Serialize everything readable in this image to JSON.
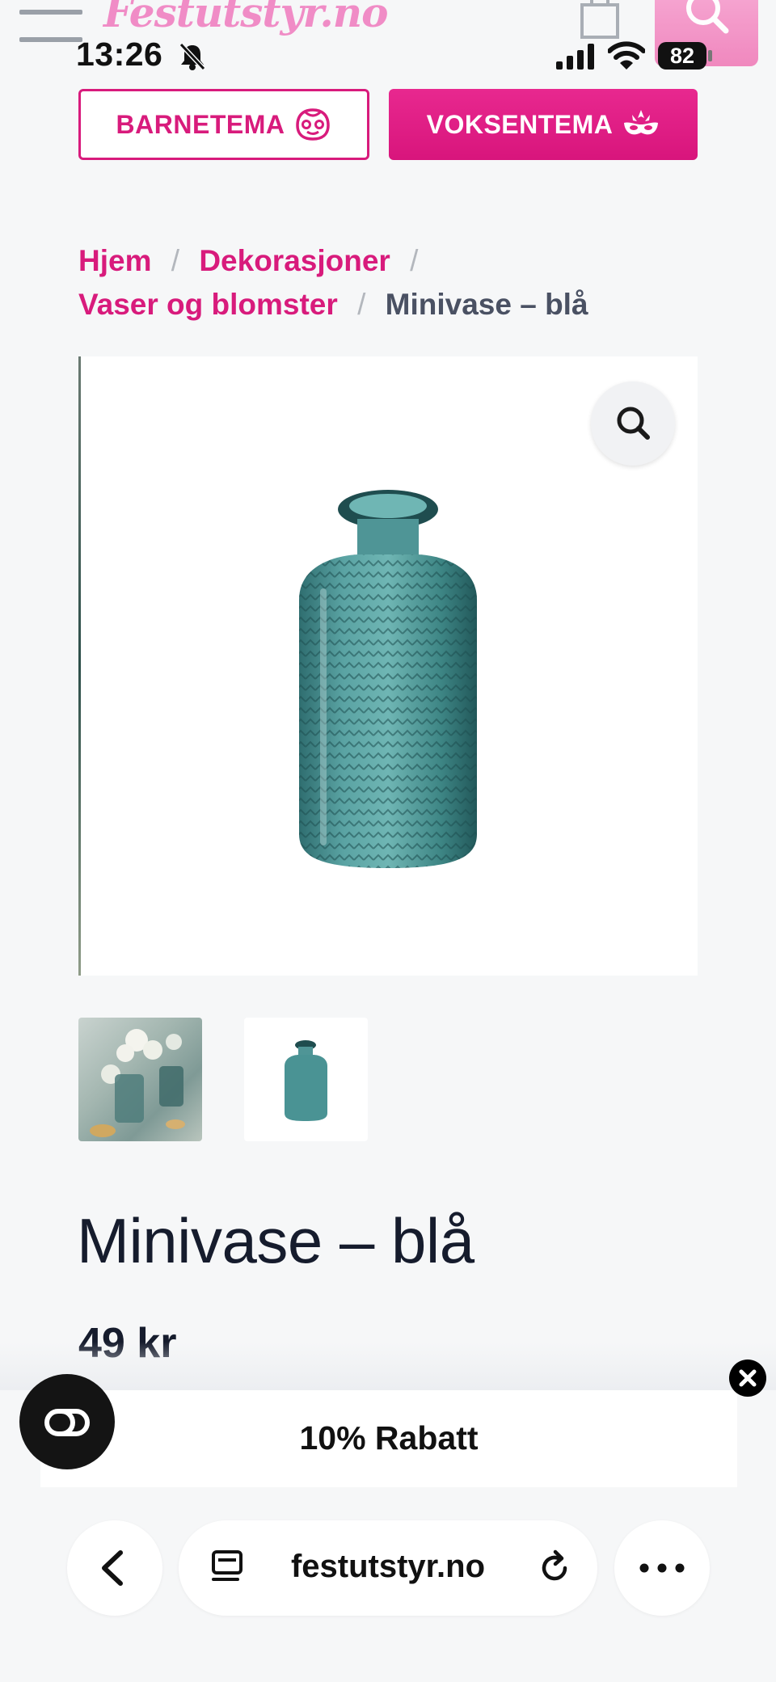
{
  "header": {
    "logo_text": "Festutstyr.no",
    "menu_icon": "hamburger-menu-icon",
    "cart_icon": "shopping-bag-icon",
    "search_icon": "search-icon",
    "accent_color": "#d81b7c"
  },
  "status_bar": {
    "time": "13:26",
    "battery": "82",
    "icons": [
      "bell-muted-icon",
      "cellular-signal-icon",
      "wifi-icon",
      "battery-icon"
    ]
  },
  "theme_buttons": {
    "children": {
      "label": "BARNETEMA",
      "icon": "kid-face-icon"
    },
    "adults": {
      "label": "VOKSENTEMA",
      "icon": "party-mask-icon"
    }
  },
  "breadcrumb": {
    "separator": "/",
    "items": [
      {
        "label": "Hjem"
      },
      {
        "label": "Dekorasjoner"
      },
      {
        "label": "Vaser og blomster"
      }
    ],
    "current": "Minivase – blå"
  },
  "gallery": {
    "zoom_icon": "magnifier-icon",
    "main_image": "teal-glass-vase",
    "thumbnails": [
      "vases-with-flowers-table",
      "teal-glass-vase"
    ]
  },
  "product": {
    "title": "Minivase – blå",
    "price": "49 kr"
  },
  "promo": {
    "text": "10% Rabatt",
    "close_icon": "close-icon",
    "chat_icon": "chat-bubble-icon"
  },
  "browser": {
    "url": "festutstyr.no",
    "back_icon": "chevron-left-icon",
    "tabs_icon": "reader-icon",
    "reload_icon": "reload-icon",
    "more_icon": "more-dots-icon"
  }
}
